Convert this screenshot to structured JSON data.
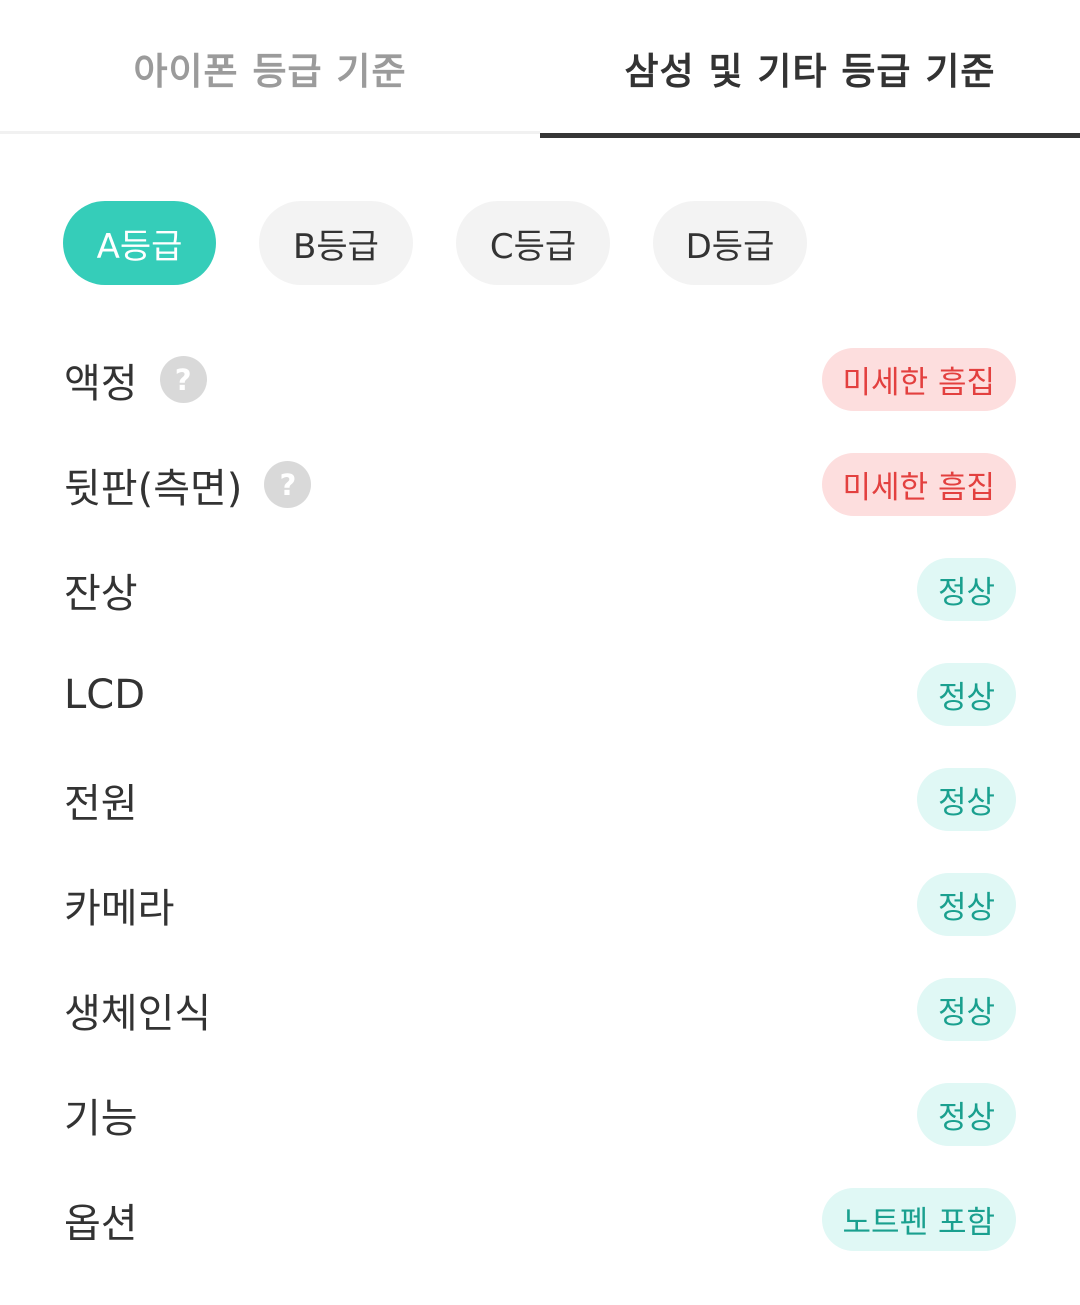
{
  "tabs": [
    {
      "label": "아이폰 등급 기준",
      "active": false
    },
    {
      "label": "삼성 및 기타 등급 기준",
      "active": true
    }
  ],
  "grades": [
    "A등급",
    "B등급",
    "C등급",
    "D등급"
  ],
  "selected_grade": "A등급",
  "help_glyph": "?",
  "rows": [
    {
      "label": "액정",
      "has_help": true,
      "status": "미세한 흠집",
      "status_type": "warn"
    },
    {
      "label": "뒷판(측면)",
      "has_help": true,
      "status": "미세한 흠집",
      "status_type": "warn"
    },
    {
      "label": "잔상",
      "has_help": false,
      "status": "정상",
      "status_type": "ok"
    },
    {
      "label": "LCD",
      "has_help": false,
      "status": "정상",
      "status_type": "ok"
    },
    {
      "label": "전원",
      "has_help": false,
      "status": "정상",
      "status_type": "ok"
    },
    {
      "label": "카메라",
      "has_help": false,
      "status": "정상",
      "status_type": "ok"
    },
    {
      "label": "생체인식",
      "has_help": false,
      "status": "정상",
      "status_type": "ok"
    },
    {
      "label": "기능",
      "has_help": false,
      "status": "정상",
      "status_type": "ok"
    },
    {
      "label": "옵션",
      "has_help": false,
      "status": "노트펜 포함",
      "status_type": "ok"
    }
  ],
  "colors": {
    "accent": "#35cdb9",
    "warn_bg": "#fddede",
    "warn_text": "#e3403f",
    "ok_bg": "#e0f8f5",
    "ok_text": "#1aa08f",
    "active_tab_bar": "#363636"
  }
}
